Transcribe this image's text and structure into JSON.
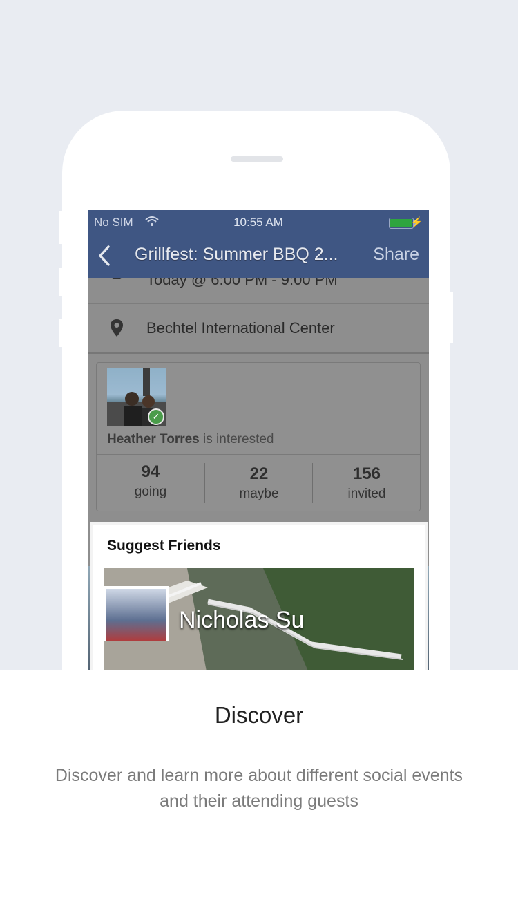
{
  "status_bar": {
    "carrier": "No SIM",
    "time": "10:55 AM",
    "battery_color": "#2ea53e"
  },
  "nav": {
    "title": "Grillfest: Summer BBQ 2...",
    "share_label": "Share",
    "back_icon": "chevron-left-icon"
  },
  "event": {
    "time_text": "Today @ 6:00 PM - 9:00 PM",
    "location": "Bechtel International Center"
  },
  "interest": {
    "name": "Heather Torres",
    "suffix": "is interested"
  },
  "stats": [
    {
      "value": "94",
      "label": "going"
    },
    {
      "value": "22",
      "label": "maybe"
    },
    {
      "value": "156",
      "label": "invited"
    }
  ],
  "suggest": {
    "heading": "Suggest Friends",
    "friend_name": "Nicholas Su"
  },
  "onboarding": {
    "title": "Discover",
    "description": "Discover and learn more about different social events and their attending guests"
  },
  "colors": {
    "background": "#e9ecf2",
    "nav_bar": "#3f5683"
  }
}
